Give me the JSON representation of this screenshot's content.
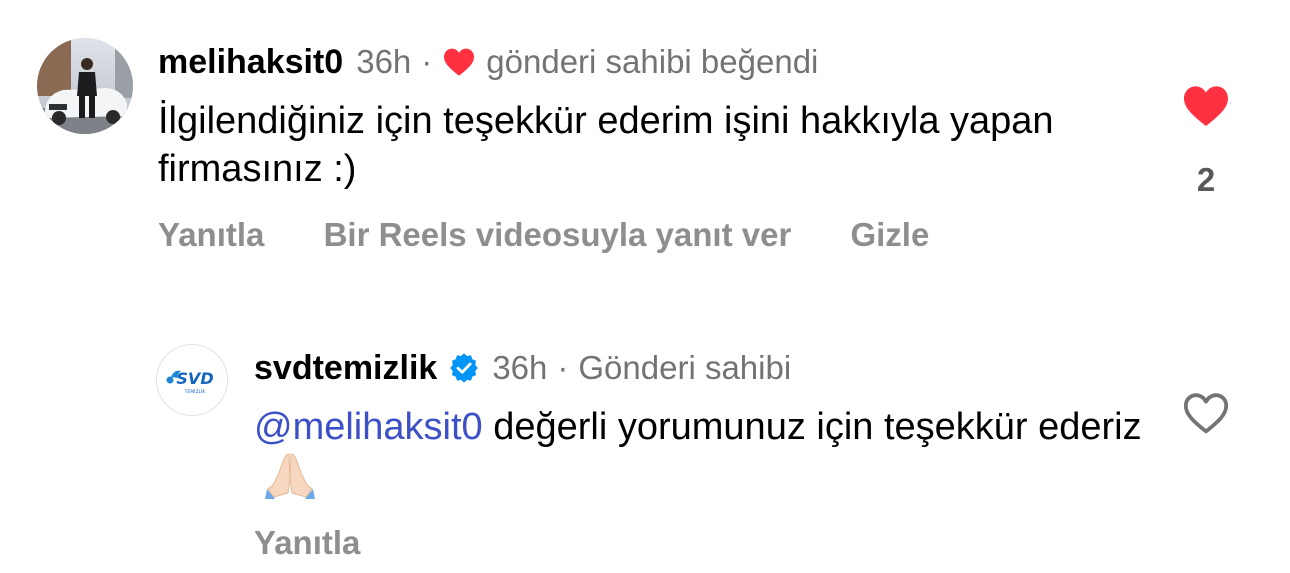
{
  "comments": [
    {
      "username": "melihaksit0",
      "time": "36h",
      "separator": "·",
      "status_text": "gönderi sahibi beğendi",
      "text": "İlgilendiğiniz için teşekkür ederim  işini hakkıyla yapan firmasınız :)",
      "like_count": "2",
      "liked": true,
      "actions": [
        "Yanıtla",
        "Bir Reels videosuyla yanıt ver",
        "Gizle"
      ],
      "avatar_icon": "user-photo-avatar",
      "liked_icon": "heart-filled-icon"
    },
    {
      "username": "svdtemizlik",
      "verified": true,
      "time": "36h",
      "separator": "·",
      "status_text": "Gönderi sahibi",
      "mention": "@melihaksit0",
      "text": " değerli yorumunuz için teşekkür ederiz",
      "emoji_icon": "folded-hands-emoji",
      "liked": false,
      "actions": [
        "Yanıtla"
      ],
      "avatar": {
        "logo_text": "SVD",
        "logo_subtext": "TEMİZLİK"
      },
      "like_icon": "heart-outline-icon"
    }
  ],
  "colors": {
    "like_red": "#ff3040",
    "mention_blue": "#3d50c8",
    "verified_blue": "#0095f6",
    "muted_text": "#737373",
    "action_gray": "#8e8e8e"
  }
}
